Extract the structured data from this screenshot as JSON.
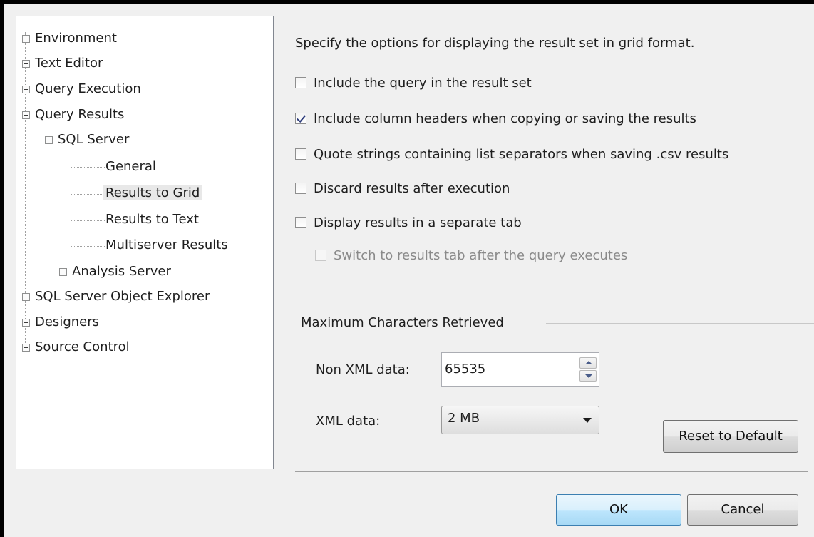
{
  "tree": {
    "items": [
      {
        "label": "Environment",
        "expander": "plus"
      },
      {
        "label": "Text Editor",
        "expander": "plus"
      },
      {
        "label": "Query Execution",
        "expander": "plus"
      },
      {
        "label": "Query Results",
        "expander": "minus"
      },
      {
        "label": "SQL Server",
        "expander": "minus"
      },
      {
        "label": "General"
      },
      {
        "label": "Results to Grid",
        "selected": true
      },
      {
        "label": "Results to Text"
      },
      {
        "label": "Multiserver Results"
      },
      {
        "label": "Analysis Server",
        "expander": "plus"
      },
      {
        "label": "SQL Server Object Explorer",
        "expander": "plus"
      },
      {
        "label": "Designers",
        "expander": "plus"
      },
      {
        "label": "Source Control",
        "expander": "plus"
      }
    ]
  },
  "main": {
    "intro": "Specify the options for displaying the result set in grid format.",
    "options": [
      {
        "label": "Include the query in the result set",
        "checked": false,
        "enabled": true
      },
      {
        "label": "Include column headers when copying or saving the results",
        "checked": true,
        "enabled": true
      },
      {
        "label": "Quote strings containing list separators when saving .csv results",
        "checked": false,
        "enabled": true
      },
      {
        "label": "Discard results after execution",
        "checked": false,
        "enabled": true
      },
      {
        "label": "Display results in a separate tab",
        "checked": false,
        "enabled": true
      },
      {
        "label": "Switch to results tab after the query executes",
        "checked": false,
        "enabled": false
      }
    ],
    "group_title": "Maximum Characters Retrieved",
    "non_xml_label": "Non XML data:",
    "non_xml_value": "65535",
    "xml_label": "XML data:",
    "xml_value": "2 MB",
    "reset_label": "Reset to Default"
  },
  "buttons": {
    "ok": "OK",
    "cancel": "Cancel"
  }
}
